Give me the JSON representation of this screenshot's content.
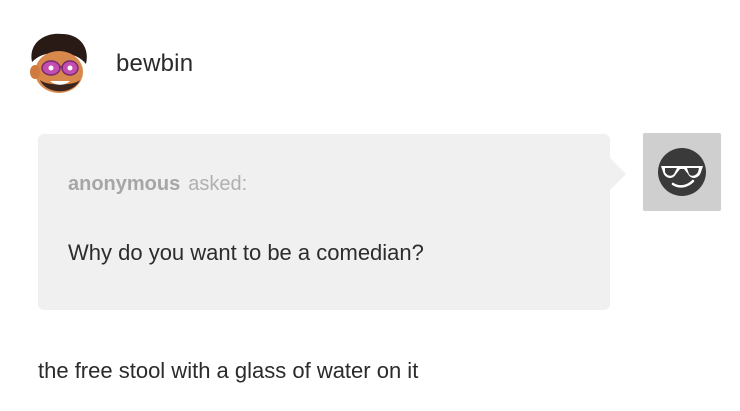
{
  "post": {
    "username": "bewbin",
    "avatar_icon": "cartoon-face-avatar-icon"
  },
  "ask": {
    "asker": "anonymous",
    "verb": "asked:",
    "question": "Why do you want to be a comedian?",
    "asker_avatar_icon": "sunglasses-face-icon",
    "box_color": "#f0f0f0"
  },
  "answer": {
    "text": "the free stool with a glass of water on it"
  }
}
